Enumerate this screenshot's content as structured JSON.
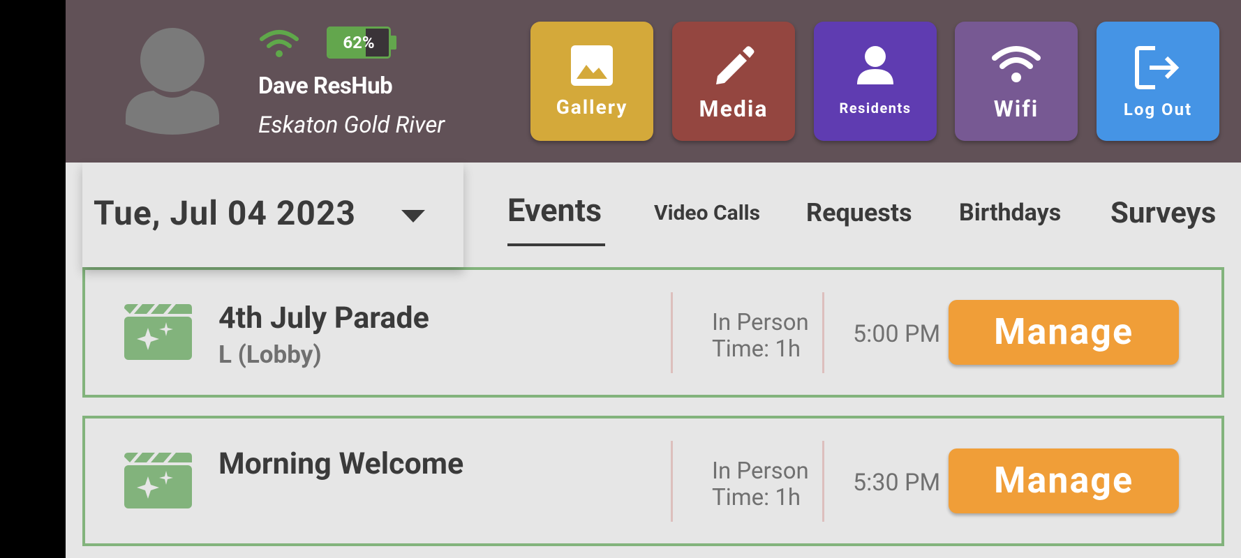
{
  "header": {
    "user_name": "Dave ResHub",
    "community": "Eskaton Gold River",
    "battery": {
      "percent_label": "62%",
      "level": 0.62
    },
    "buttons": [
      {
        "label": "Gallery",
        "icon": "image-icon",
        "color": "#d4a93a"
      },
      {
        "label": "Media",
        "icon": "pencil-icon",
        "color": "#944640"
      },
      {
        "label": "Residents",
        "icon": "person-icon",
        "color": "#5f3cb1"
      },
      {
        "label": "Wifi",
        "icon": "wifi-icon",
        "color": "#775993"
      },
      {
        "label": "Log Out",
        "icon": "logout-icon",
        "color": "#4594e5"
      }
    ]
  },
  "date_picker": {
    "value": "Tue, Jul 04 2023"
  },
  "tabs": [
    {
      "label": "Events",
      "active": true
    },
    {
      "label": "Video Calls",
      "active": false
    },
    {
      "label": "Requests",
      "active": false
    },
    {
      "label": "Birthdays",
      "active": false
    },
    {
      "label": "Surveys",
      "active": false
    }
  ],
  "events": [
    {
      "title": "4th July Parade",
      "location": "L (Lobby)",
      "type": "In Person",
      "duration": "Time: 1h",
      "time": "5:00 PM",
      "action": "Manage",
      "icon": "event-clapper-sparkle-icon"
    },
    {
      "title": "Morning Welcome",
      "location": "",
      "type": "In Person",
      "duration": "Time: 1h",
      "time": "5:30 PM",
      "action": "Manage",
      "icon": "event-clapper-sparkle-icon"
    }
  ],
  "colors": {
    "header_bg": "#615157",
    "accent_green": "#82b37c",
    "manage_orange": "#f09e38",
    "battery_green": "#63a64d"
  }
}
